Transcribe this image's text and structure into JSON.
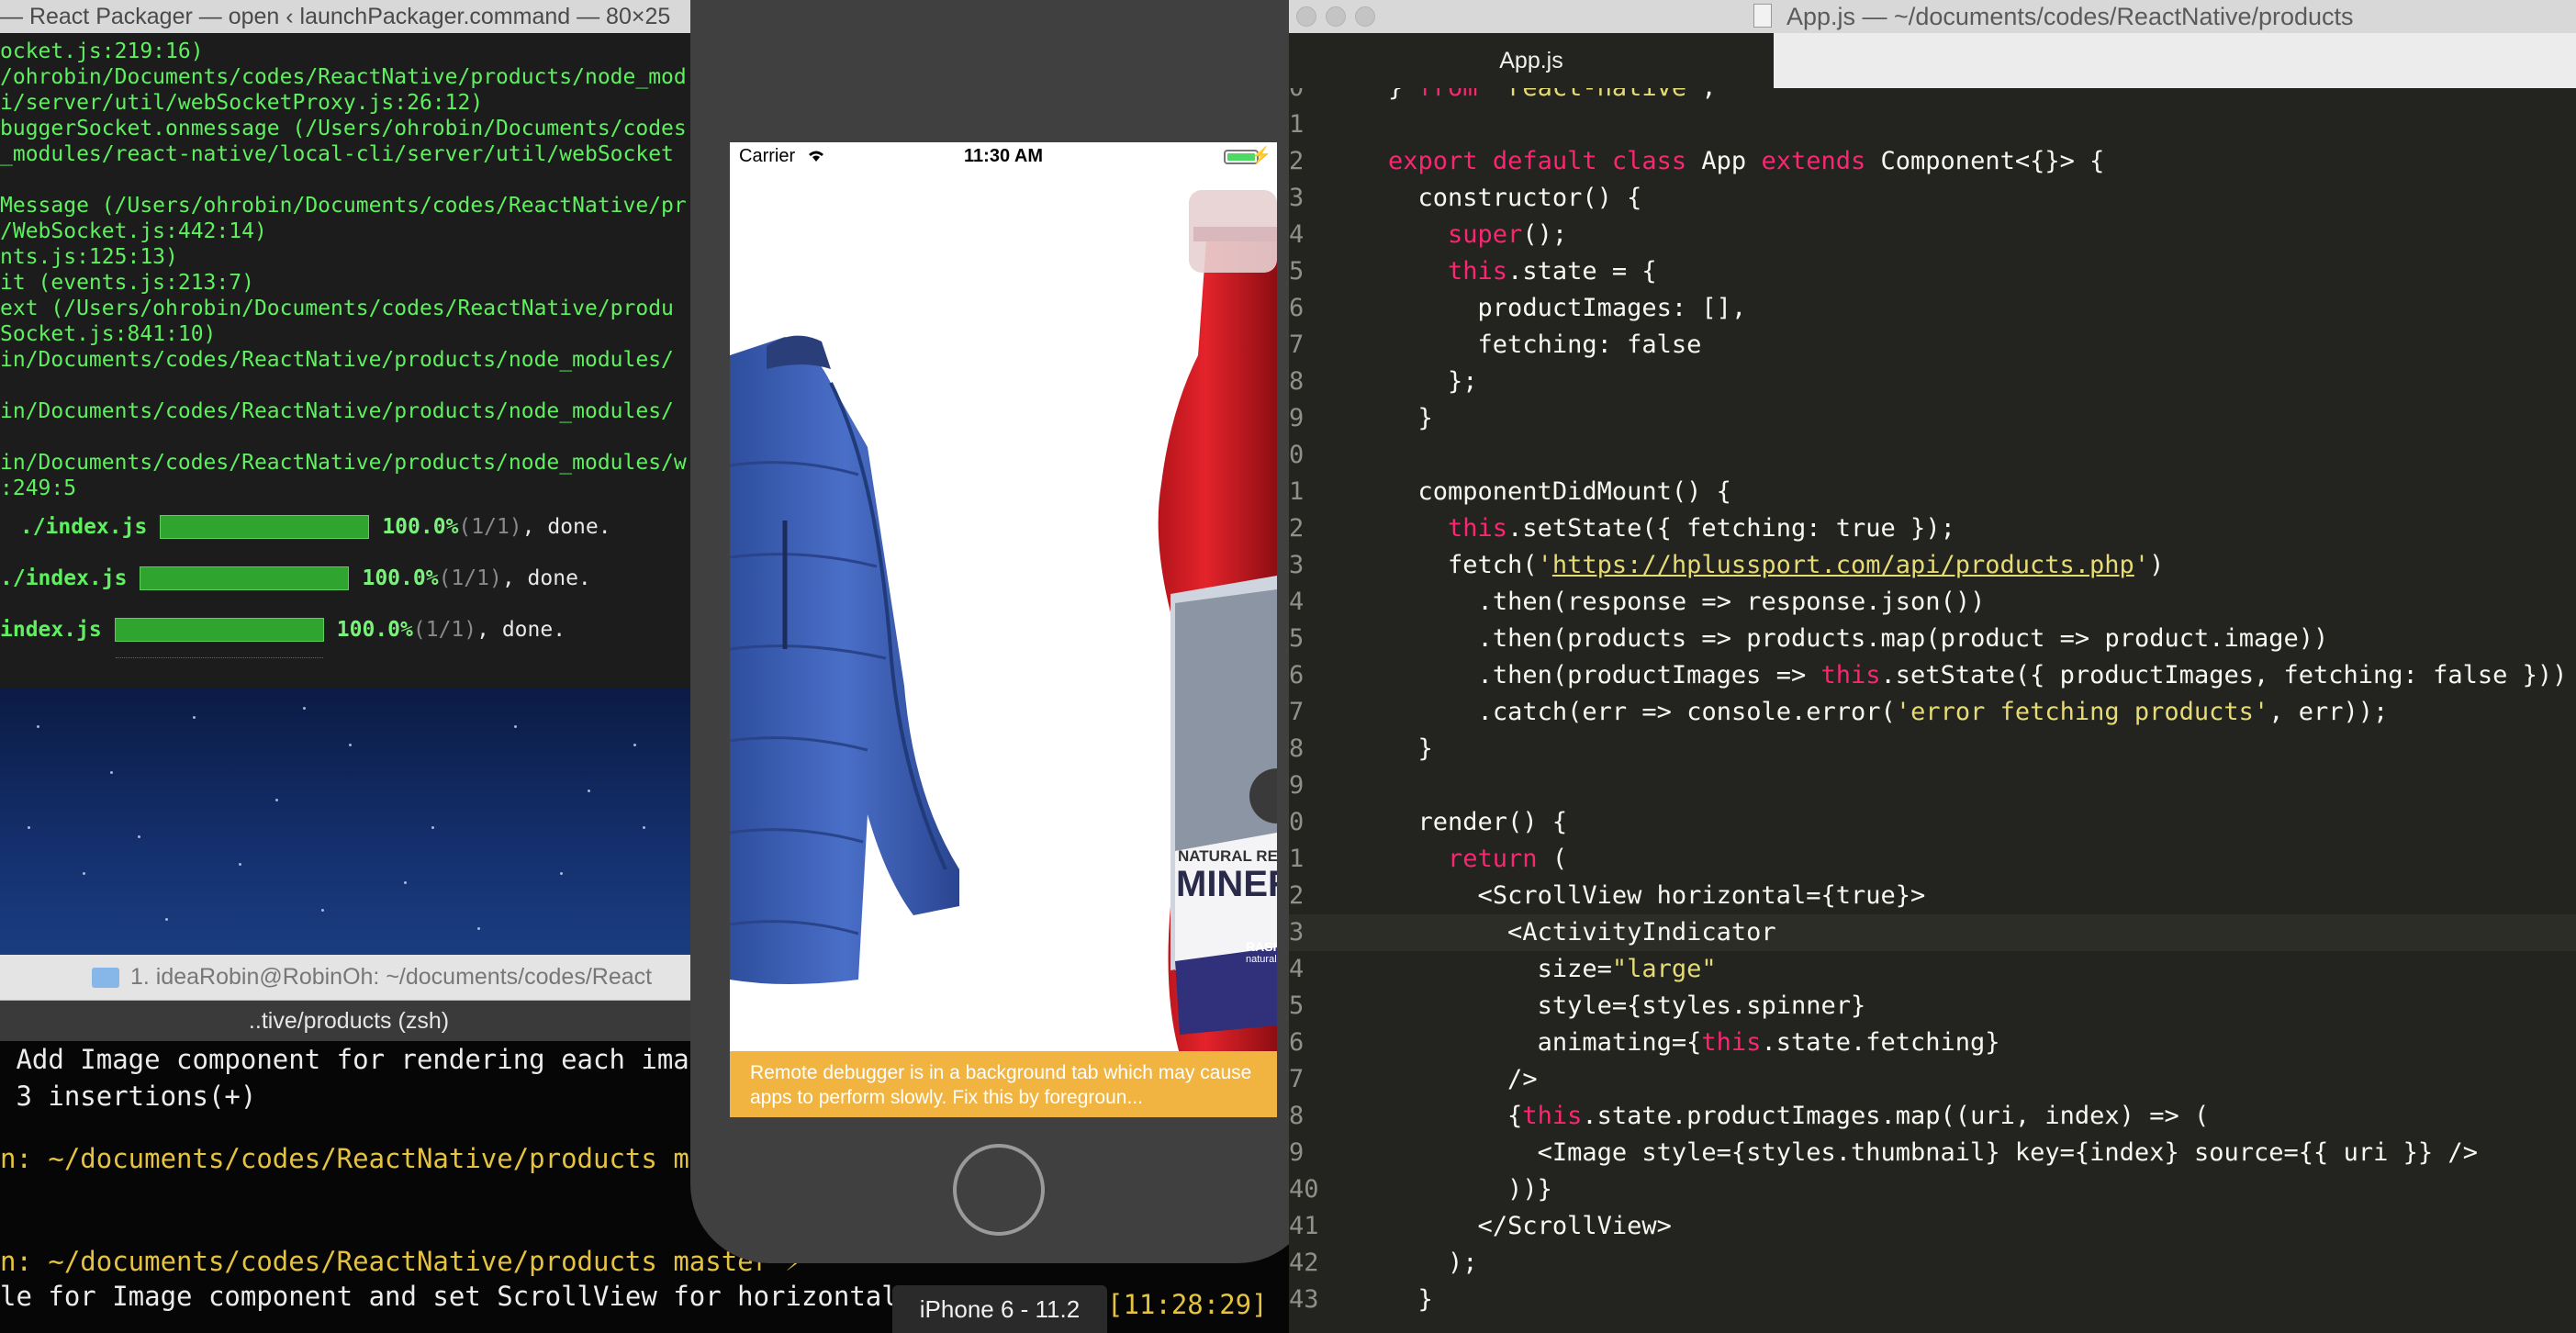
{
  "terminal_packager": {
    "title": "— React Packager — open ‹ launchPackager.command — 80×25",
    "lines": [
      "ocket.js:219:16)",
      "/ohrobin/Documents/codes/ReactNative/products/node_mod",
      "i/server/util/webSocketProxy.js:26:12)",
      "buggerSocket.onmessage (/Users/ohrobin/Documents/codes",
      "_modules/react-native/local-cli/server/util/webSocket",
      "",
      "Message (/Users/ohrobin/Documents/codes/ReactNative/pr",
      "/WebSocket.js:442:14)",
      "nts.js:125:13)",
      "it (events.js:213:7)",
      "ext (/Users/ohrobin/Documents/codes/ReactNative/produ",
      "Socket.js:841:10)",
      "in/Documents/codes/ReactNative/products/node_modules/",
      "",
      "in/Documents/codes/ReactNative/products/node_modules/",
      "",
      "in/Documents/codes/ReactNative/products/node_modules/w",
      ":249:5"
    ],
    "progress": [
      {
        "file": " ./index.js",
        "percent": "100.0%",
        "count": "(1/1)",
        "status": ", done.",
        "fraction": 1.0
      },
      {
        "file": "./index.js",
        "percent": "100.0%",
        "count": "(1/1)",
        "status": ", done.",
        "fraction": 1.0
      },
      {
        "file": "index.js",
        "percent": "100.0%",
        "count": "(1/1)",
        "status": ", done.",
        "fraction": 1.0
      }
    ]
  },
  "terminal_tabbar": {
    "label": "1. ideaRobin@RobinOh: ~/documents/codes/React"
  },
  "terminal_zsh": {
    "title": "..tive/products (zsh)",
    "line1": " Add Image component for rendering each images",
    "line2": " 3 insertions(+)",
    "prompt1_path": "n: ~/documents/codes/ReactNative/products ",
    "prompt1_branch": "master",
    "prompt2_path": "n: ~/documents/codes/ReactNative/products ",
    "prompt2_branch": "master ⚡",
    "line5": "le for Image component and set ScrollView for horizontal scro",
    "time": "[11:28:29]"
  },
  "simulator": {
    "carrier": "Carrier",
    "time": "11:30 AM",
    "debug_banner": "Remote debugger is in a background tab which may cause apps to perform slowly. Fix this by foregroun...",
    "bottle_label_small": "NATURAL RE",
    "bottle_label_big": "MINERA",
    "bottle_label_tag1": "RASI",
    "bottle_label_tag2": "natural",
    "device_label": "iPhone 6 - 11.2"
  },
  "editor": {
    "window_title": "App.js — ~/documents/codes/ReactNative/products",
    "tab": "App.js",
    "line_numbers": [
      "0",
      "1",
      "2",
      "3",
      "4",
      "5",
      "6",
      "7",
      "8",
      "9",
      "0",
      "1",
      "2",
      "3",
      "4",
      "5",
      "6",
      "7",
      "8",
      "9",
      "0",
      "1",
      "2",
      "3",
      "4",
      "5",
      "6",
      "7",
      "8",
      "9",
      "40",
      "41",
      "42",
      "43"
    ],
    "lines": [
      "} from 'react-native';",
      "",
      "export default class App extends Component<{}> {",
      "  constructor() {",
      "    super();",
      "    this.state = {",
      "      productImages: [],",
      "      fetching: false",
      "    };",
      "  }",
      "",
      "  componentDidMount() {",
      "    this.setState({ fetching: true });",
      "    fetch('https://hplussport.com/api/products.php')",
      "      .then(response => response.json())",
      "      .then(products => products.map(product => product.image))",
      "      .then(productImages => this.setState({ productImages, fetching: false }))",
      "      .catch(err => console.error('error fetching products', err));",
      "  }",
      "",
      "  render() {",
      "    return (",
      "      <ScrollView horizontal={true}>",
      "        <ActivityIndicator",
      "          size=\"large\"",
      "          style={styles.spinner}",
      "          animating={this.state.fetching}",
      "        />",
      "        {this.state.productImages.map((uri, index) => (",
      "          <Image style={styles.thumbnail} key={index} source={{ uri }} />",
      "        ))}",
      "      </ScrollView>",
      "    );",
      "  }"
    ],
    "current_line_index": 23
  }
}
